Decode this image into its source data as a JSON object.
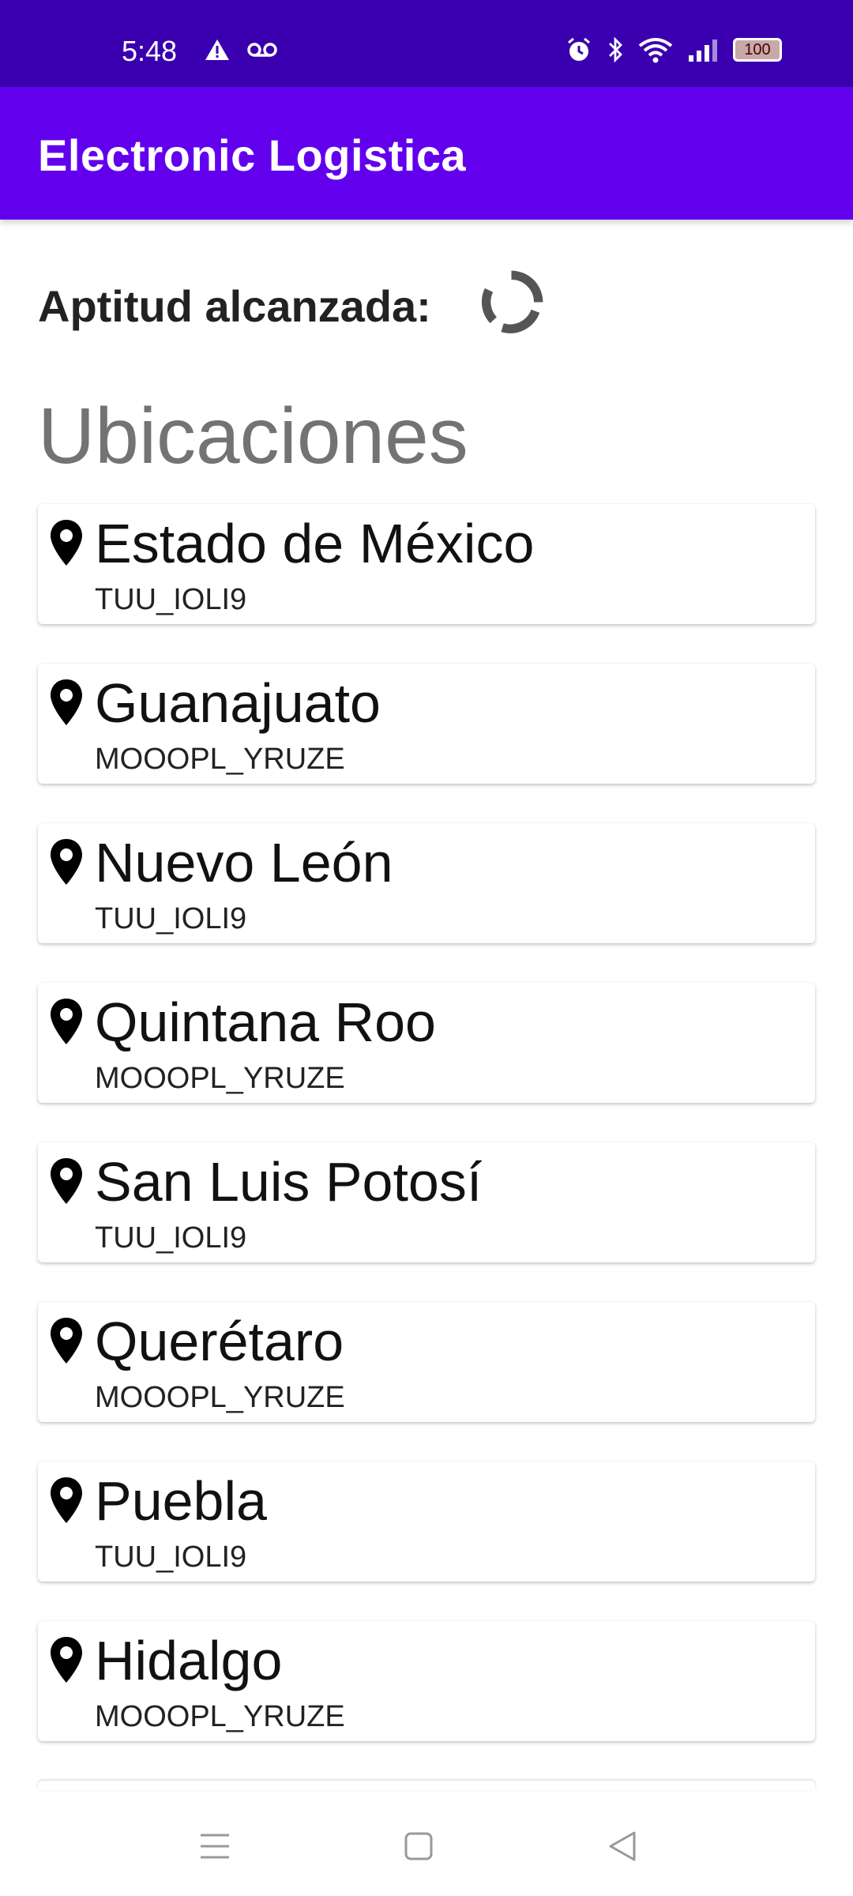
{
  "status_bar": {
    "time": "5:48",
    "battery": "100",
    "icons_left": [
      "warning-icon",
      "voicemail-icon"
    ],
    "icons_right": [
      "alarm-icon",
      "bluetooth-icon",
      "wifi-icon",
      "signal-icon",
      "battery-icon"
    ]
  },
  "app_bar": {
    "title": "Electronic Logistica"
  },
  "fitness": {
    "label": "Aptitud alcanzada:"
  },
  "section": {
    "title": "Ubicaciones"
  },
  "locations": [
    {
      "name": "Estado de México",
      "code": "TUU_IOLI9"
    },
    {
      "name": "Guanajuato",
      "code": "MOOOPL_YRUZE"
    },
    {
      "name": "Nuevo León",
      "code": "TUU_IOLI9"
    },
    {
      "name": "Quintana Roo",
      "code": "MOOOPL_YRUZE"
    },
    {
      "name": "San Luis Potosí",
      "code": "TUU_IOLI9"
    },
    {
      "name": "Querétaro",
      "code": "MOOOPL_YRUZE"
    },
    {
      "name": "Puebla",
      "code": "TUU_IOLI9"
    },
    {
      "name": "Hidalgo",
      "code": "MOOOPL_YRUZE"
    }
  ],
  "colors": {
    "status_bar": "#3a00b0",
    "app_bar": "#6200ee",
    "section_title": "#737373"
  }
}
